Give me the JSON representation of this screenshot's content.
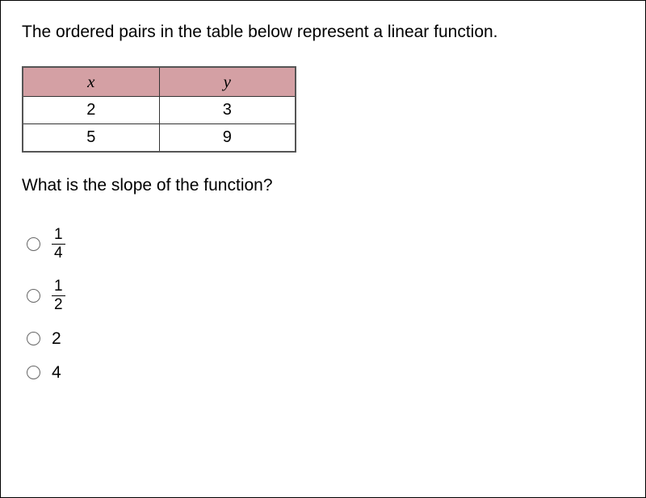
{
  "prompt": "The ordered pairs in the table below represent a linear function.",
  "table": {
    "headers": {
      "x": "x",
      "y": "y"
    },
    "rows": [
      {
        "x": "2",
        "y": "3"
      },
      {
        "x": "5",
        "y": "9"
      }
    ]
  },
  "question": "What is the slope of the function?",
  "options": {
    "a": {
      "numerator": "1",
      "denominator": "4"
    },
    "b": {
      "numerator": "1",
      "denominator": "2"
    },
    "c": {
      "value": "2"
    },
    "d": {
      "value": "4"
    }
  }
}
